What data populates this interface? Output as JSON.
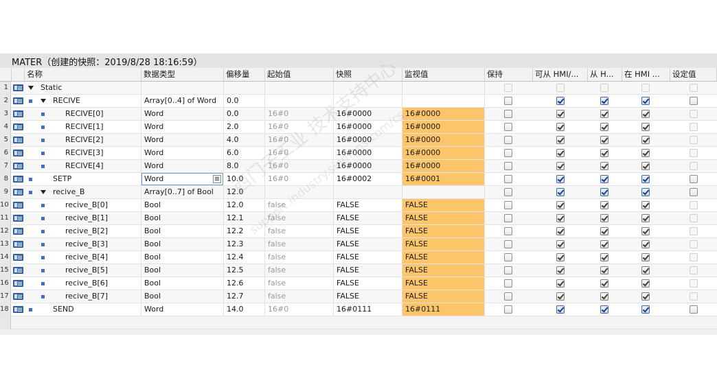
{
  "title": "MATER（创建的快照：2019/8/28 18:16:59）",
  "columns": {
    "name": "名称",
    "datatype": "数据类型",
    "offset": "偏移量",
    "start": "起始值",
    "snapshot": "快照",
    "monitor": "监视值",
    "retain": "保持",
    "hmi_access": "可从 HMI/...",
    "hmi_write": "从 H...",
    "hmi_visible": "在 HMI ...",
    "setpoint": "设定值"
  },
  "rows": [
    {
      "num": "1",
      "name": "Static",
      "type": "",
      "offset": "",
      "start": "",
      "snap": "",
      "monitor": "",
      "retain": false,
      "access": false,
      "write": false,
      "visible": false,
      "set": false
    },
    {
      "num": "2",
      "name": "RECIVE",
      "type": "Array[0..4] of Word",
      "offset": "0.0",
      "start": "",
      "snap": "",
      "monitor": "",
      "retain": false,
      "access": true,
      "write": true,
      "visible": true,
      "set": false
    },
    {
      "num": "3",
      "name": "RECIVE[0]",
      "type": "Word",
      "offset": "0.0",
      "start": "16#0",
      "snap": "16#0000",
      "monitor": "16#0000",
      "retain": false,
      "access": true,
      "write": true,
      "visible": true,
      "set": false
    },
    {
      "num": "4",
      "name": "RECIVE[1]",
      "type": "Word",
      "offset": "2.0",
      "start": "16#0",
      "snap": "16#0000",
      "monitor": "16#0000",
      "retain": false,
      "access": true,
      "write": true,
      "visible": true,
      "set": false
    },
    {
      "num": "5",
      "name": "RECIVE[2]",
      "type": "Word",
      "offset": "4.0",
      "start": "16#0",
      "snap": "16#0000",
      "monitor": "16#0000",
      "retain": false,
      "access": true,
      "write": true,
      "visible": true,
      "set": false
    },
    {
      "num": "6",
      "name": "RECIVE[3]",
      "type": "Word",
      "offset": "6.0",
      "start": "16#0",
      "snap": "16#0000",
      "monitor": "16#0000",
      "retain": false,
      "access": true,
      "write": true,
      "visible": true,
      "set": false
    },
    {
      "num": "7",
      "name": "RECIVE[4]",
      "type": "Word",
      "offset": "8.0",
      "start": "16#0",
      "snap": "16#0000",
      "monitor": "16#0000",
      "retain": false,
      "access": true,
      "write": true,
      "visible": true,
      "set": false
    },
    {
      "num": "8",
      "name": "SETP",
      "type": "Word",
      "offset": "10.0",
      "start": "16#0",
      "snap": "16#0002",
      "monitor": "16#0001",
      "retain": false,
      "access": true,
      "write": true,
      "visible": true,
      "set": false
    },
    {
      "num": "9",
      "name": "recive_B",
      "type": "Array[0..7] of Bool",
      "offset": "12.0",
      "start": "",
      "snap": "",
      "monitor": "",
      "retain": false,
      "access": true,
      "write": true,
      "visible": true,
      "set": false
    },
    {
      "num": "10",
      "name": "recive_B[0]",
      "type": "Bool",
      "offset": "12.0",
      "start": "false",
      "snap": "FALSE",
      "monitor": "FALSE",
      "retain": false,
      "access": true,
      "write": true,
      "visible": true,
      "set": false
    },
    {
      "num": "11",
      "name": "recive_B[1]",
      "type": "Bool",
      "offset": "12.1",
      "start": "false",
      "snap": "FALSE",
      "monitor": "FALSE",
      "retain": false,
      "access": true,
      "write": true,
      "visible": true,
      "set": false
    },
    {
      "num": "12",
      "name": "recive_B[2]",
      "type": "Bool",
      "offset": "12.2",
      "start": "false",
      "snap": "FALSE",
      "monitor": "FALSE",
      "retain": false,
      "access": true,
      "write": true,
      "visible": true,
      "set": false
    },
    {
      "num": "13",
      "name": "recive_B[3]",
      "type": "Bool",
      "offset": "12.3",
      "start": "false",
      "snap": "FALSE",
      "monitor": "FALSE",
      "retain": false,
      "access": true,
      "write": true,
      "visible": true,
      "set": false
    },
    {
      "num": "14",
      "name": "recive_B[4]",
      "type": "Bool",
      "offset": "12.4",
      "start": "false",
      "snap": "FALSE",
      "monitor": "FALSE",
      "retain": false,
      "access": true,
      "write": true,
      "visible": true,
      "set": false
    },
    {
      "num": "15",
      "name": "recive_B[5]",
      "type": "Bool",
      "offset": "12.5",
      "start": "false",
      "snap": "FALSE",
      "monitor": "FALSE",
      "retain": false,
      "access": true,
      "write": true,
      "visible": true,
      "set": false
    },
    {
      "num": "16",
      "name": "recive_B[6]",
      "type": "Bool",
      "offset": "12.6",
      "start": "false",
      "snap": "FALSE",
      "monitor": "FALSE",
      "retain": false,
      "access": true,
      "write": true,
      "visible": true,
      "set": false
    },
    {
      "num": "17",
      "name": "recive_B[7]",
      "type": "Bool",
      "offset": "12.7",
      "start": "false",
      "snap": "FALSE",
      "monitor": "FALSE",
      "retain": false,
      "access": true,
      "write": true,
      "visible": true,
      "set": false
    },
    {
      "num": "18",
      "name": "SEND",
      "type": "Word",
      "offset": "14.0",
      "start": "16#0",
      "snap": "16#0111",
      "monitor": "16#0111",
      "retain": false,
      "access": true,
      "write": true,
      "visible": true,
      "set": false
    }
  ],
  "colors": {
    "monitor_highlight": "#fcc56a",
    "bullet": "#3d6fc7",
    "db_icon": "#3f6fb3"
  },
  "watermark": {
    "line1": "西门子工业 技术支持中心",
    "line2": "support.industry.siemens.com/cs"
  },
  "icons": {
    "row": "db-element-icon",
    "expand": "expand-triangle-icon",
    "member": "member-bullet-icon",
    "dropdown": "list-button-icon"
  }
}
